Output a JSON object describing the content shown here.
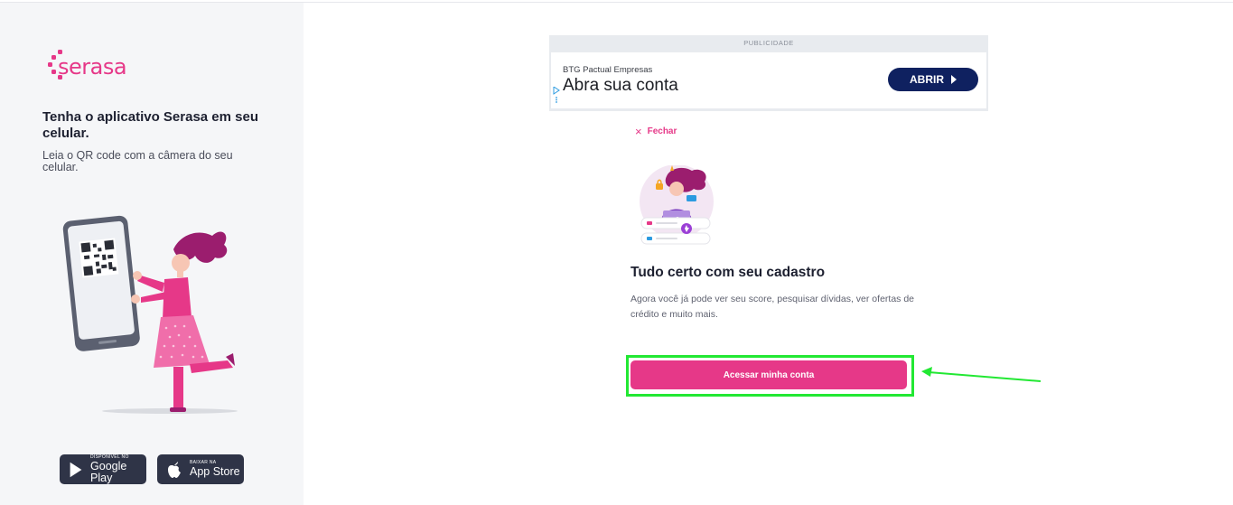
{
  "sidebar": {
    "logo_text": "serasa",
    "title": "Tenha o aplicativo Serasa em seu celular.",
    "description": "Leia o QR code com a câmera do seu celular.",
    "google_play": {
      "small": "Disponível no",
      "big": "Google Play"
    },
    "app_store": {
      "small": "Baixar na",
      "big": "App Store"
    }
  },
  "ad": {
    "header": "PUBLICIDADE",
    "advertiser": "BTG Pactual Empresas",
    "headline": "Abra sua conta",
    "button": "ABRIR"
  },
  "main": {
    "close_label": "Fechar",
    "close_glyph": "×",
    "title": "Tudo certo com seu cadastro",
    "description": "Agora você já pode ver seu score, pesquisar dívidas, ver ofertas de crédito e muito mais.",
    "cta": "Acessar minha conta"
  },
  "colors": {
    "brand": "#e63888",
    "ad_button": "#0f2160",
    "highlight": "#22e833",
    "sidebar_bg": "#f5f6f8"
  }
}
